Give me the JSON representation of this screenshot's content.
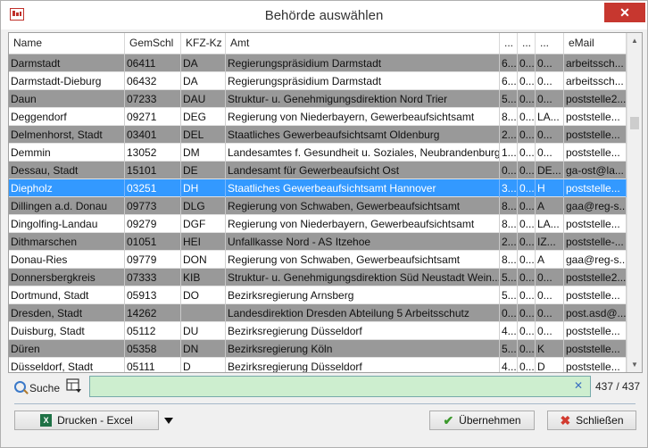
{
  "window": {
    "title": "Behörde auswählen",
    "close_glyph": "✕"
  },
  "grid": {
    "columns": [
      "Name",
      "GemSchl",
      "KFZ-Kz",
      "Amt",
      "...",
      "...",
      "...",
      "eMail"
    ],
    "rows": [
      {
        "style": "gray",
        "cells": [
          "Darmstadt",
          "06411",
          "DA",
          "Regierungspräsidium Darmstadt",
          "6...",
          "0...",
          "0...",
          "arbeitssch..."
        ]
      },
      {
        "style": "white",
        "cells": [
          "Darmstadt-Dieburg",
          "06432",
          "DA",
          "Regierungspräsidium Darmstadt",
          "6...",
          "0...",
          "0...",
          "arbeitssch..."
        ]
      },
      {
        "style": "gray",
        "cells": [
          "Daun",
          "07233",
          "DAU",
          "Struktur- u. Genehmigungsdirektion Nord Trier",
          "5...",
          "0...",
          "0...",
          "poststelle2..."
        ]
      },
      {
        "style": "white",
        "cells": [
          "Deggendorf",
          "09271",
          "DEG",
          "Regierung von Niederbayern, Gewerbeaufsichtsamt",
          "8...",
          "0...",
          "LA...",
          "poststelle..."
        ]
      },
      {
        "style": "gray",
        "cells": [
          "Delmenhorst, Stadt",
          "03401",
          "DEL",
          "Staatliches Gewerbeaufsichtsamt Oldenburg",
          "2...",
          "0...",
          "0...",
          "poststelle..."
        ]
      },
      {
        "style": "white",
        "cells": [
          "Demmin",
          "13052",
          "DM",
          "Landesamtes f. Gesundheit u. Soziales, Neubrandenburg",
          "1...",
          "0...",
          "0...",
          "poststelle..."
        ]
      },
      {
        "style": "gray",
        "cells": [
          "Dessau, Stadt",
          "15101",
          "DE",
          "Landesamt für Gewerbeaufsicht Ost",
          "0...",
          "0...",
          "DE...",
          "ga-ost@la..."
        ]
      },
      {
        "style": "sel",
        "cells": [
          "Diepholz",
          "03251",
          "DH",
          "Staatliches Gewerbeaufsichtsamt Hannover",
          "3...",
          "0...",
          "H",
          "poststelle..."
        ]
      },
      {
        "style": "gray",
        "cells": [
          "Dillingen a.d. Donau",
          "09773",
          "DLG",
          "Regierung von Schwaben, Gewerbeaufsichtsamt",
          "8...",
          "0...",
          "A",
          "gaa@reg-s..."
        ]
      },
      {
        "style": "white",
        "cells": [
          "Dingolfing-Landau",
          "09279",
          "DGF",
          "Regierung von Niederbayern, Gewerbeaufsichtsamt",
          "8...",
          "0...",
          "LA...",
          "poststelle..."
        ]
      },
      {
        "style": "gray",
        "cells": [
          "Dithmarschen",
          "01051",
          "HEI",
          "Unfallkasse Nord - AS Itzehoe",
          "2...",
          "0...",
          "IZ...",
          "poststelle-..."
        ]
      },
      {
        "style": "white",
        "cells": [
          "Donau-Ries",
          "09779",
          "DON",
          "Regierung von Schwaben, Gewerbeaufsichtsamt",
          "8...",
          "0...",
          "A",
          "gaa@reg-s..."
        ]
      },
      {
        "style": "gray",
        "cells": [
          "Donnersbergkreis",
          "07333",
          "KIB",
          "Struktur- u. Genehmigungsdirektion Süd Neustadt Wein...",
          "5...",
          "0...",
          "0...",
          "poststelle2..."
        ]
      },
      {
        "style": "white",
        "cells": [
          "Dortmund, Stadt",
          "05913",
          "DO",
          "Bezirksregierung Arnsberg",
          "5...",
          "0...",
          "0...",
          "poststelle..."
        ]
      },
      {
        "style": "gray",
        "cells": [
          "Dresden, Stadt",
          "14262",
          "",
          "Landesdirektion Dresden Abteilung 5 Arbeitsschutz",
          "0...",
          "0...",
          "0...",
          "post.asd@..."
        ]
      },
      {
        "style": "white",
        "cells": [
          "Duisburg, Stadt",
          "05112",
          "DU",
          "Bezirksregierung Düsseldorf",
          "4...",
          "0...",
          "0...",
          "poststelle..."
        ]
      },
      {
        "style": "gray",
        "cells": [
          "Düren",
          "05358",
          "DN",
          "Bezirksregierung Köln",
          "5...",
          "0...",
          "K",
          "poststelle..."
        ]
      },
      {
        "style": "white",
        "cells": [
          "Düsseldorf, Stadt",
          "05111",
          "D",
          "Bezirksregierung Düsseldorf",
          "4...",
          "0...",
          "D",
          "poststelle..."
        ]
      }
    ]
  },
  "search": {
    "label": "Suche",
    "value": "",
    "clear_glyph": "✕",
    "count": "437 / 437"
  },
  "buttons": {
    "excel": "Drucken - Excel",
    "ok": "Übernehmen",
    "close": "Schließen"
  },
  "colors": {
    "row_gray": "#999999",
    "row_selected": "#3399ff",
    "search_bg": "#cdeecf",
    "close_red": "#c7372f"
  }
}
